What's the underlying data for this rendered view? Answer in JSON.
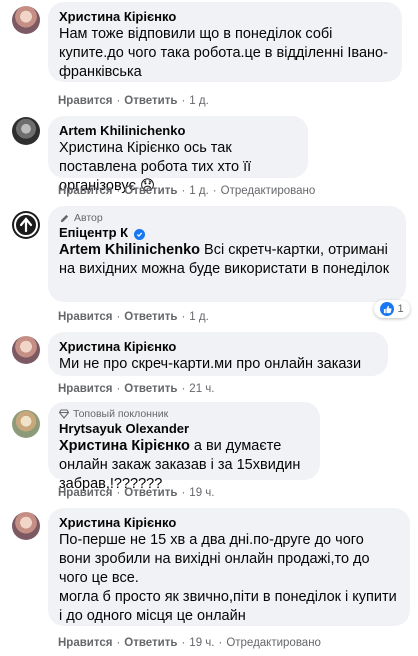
{
  "actions": {
    "like": "Нравится",
    "reply": "Ответить",
    "separator": "·"
  },
  "comments": [
    {
      "author": "Христина Кірієнко",
      "text": "Нам тоже відповили що в понеділок собі купите.до чого така робота.це в відділенні Івано-франківська",
      "time": "1 д."
    },
    {
      "author": "Artem Khilinichenko",
      "text": "Христина Кірієнко ось так поставлена робота тих хто її організовує 😞",
      "time": "1 д.",
      "edited": "Отредактировано"
    },
    {
      "badge": "Автор",
      "author": "Епіцентр К",
      "mention": "Artem Khilinichenko",
      "text": " Всі скретч-картки, отримані на вихідних можна буде використати в понеділок",
      "time": "1 д.",
      "reaction_count": "1"
    },
    {
      "author": "Христина Кірієнко",
      "text": "Ми не про скреч-карти.ми про онлайн закази",
      "time": "21 ч."
    },
    {
      "badge": "Топовый поклонник",
      "author": "Hrytsayuk Olexander",
      "mention": "Христина Кірієнко",
      "text": " а ви думаєте онлайн закаж заказав і за 15хвидин забрав,!??????",
      "time": "19 ч."
    },
    {
      "author": "Христина Кірієнко",
      "text": "По-перше не 15 хв а два дні.по-друге до чого вони зробили на вихідні онлайн продажі,то до чого це все.\nмогла б просто як звично,піти в понеділок і купити і до одного місця це онлайн",
      "time": "19 ч.",
      "edited": "Отредактировано"
    }
  ],
  "colors": {
    "bubble": "#f0f2f5",
    "meta": "#65676b",
    "like_blue": "#1877f2"
  }
}
